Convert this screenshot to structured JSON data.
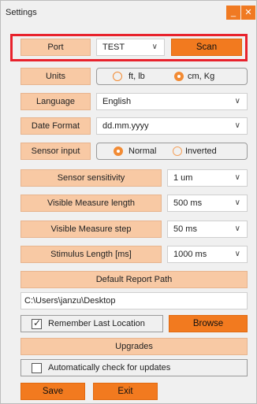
{
  "window": {
    "title": "Settings",
    "minimize_glyph": "_",
    "close_glyph": "✕"
  },
  "port": {
    "label": "Port",
    "value": "TEST",
    "scan_label": "Scan"
  },
  "units": {
    "label": "Units",
    "options": [
      "ft, lb",
      "cm, Kg"
    ],
    "selected": "cm, Kg"
  },
  "language": {
    "label": "Language",
    "value": "English"
  },
  "date_format": {
    "label": "Date Format",
    "value": "dd.mm.yyyy"
  },
  "sensor_input": {
    "label": "Sensor input",
    "options": [
      "Normal",
      "Inverted"
    ],
    "selected": "Normal"
  },
  "sensor_sensitivity": {
    "label": "Sensor sensitivity",
    "value": "1 um"
  },
  "visible_measure_length": {
    "label": "Visible Measure length",
    "value": "500 ms"
  },
  "visible_measure_step": {
    "label": "Visible Measure step",
    "value": "50 ms"
  },
  "stimulus_length": {
    "label": "Stimulus Length [ms]",
    "value": "1000 ms"
  },
  "report_path": {
    "label": "Default Report Path",
    "value": "C:\\Users\\janzu\\Desktop"
  },
  "remember": {
    "label": "Remember Last Location",
    "checked": true,
    "browse_label": "Browse"
  },
  "upgrades": {
    "label": "Upgrades",
    "auto_check_label": "Automatically check for updates",
    "auto_check_checked": false
  },
  "actions": {
    "save_label": "Save",
    "exit_label": "Exit"
  },
  "icons": {
    "dropdown": "chevron-down-icon",
    "check": "check-icon"
  },
  "colors": {
    "accent": "#f27a1f",
    "label_bg": "#f8c9a4",
    "highlight": "#e8222c"
  }
}
